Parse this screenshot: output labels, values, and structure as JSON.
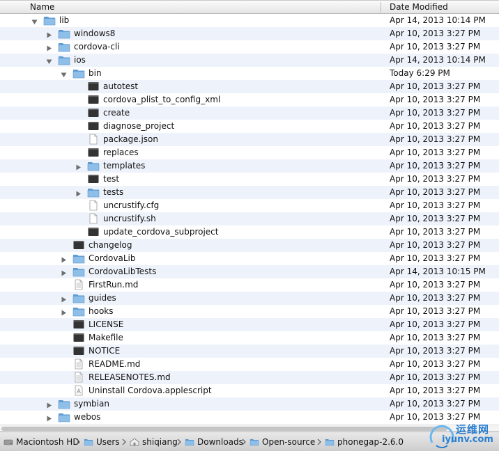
{
  "columns": {
    "name": "Name",
    "date_modified": "Date Modified"
  },
  "rows": [
    {
      "name": "lib",
      "date": "Apr 14, 2013 10:14 PM",
      "depth": 0,
      "kind": "folder",
      "disclosure": "open"
    },
    {
      "name": "windows8",
      "date": "Apr 10, 2013 3:27 PM",
      "depth": 1,
      "kind": "folder",
      "disclosure": "closed"
    },
    {
      "name": "cordova-cli",
      "date": "Apr 10, 2013 3:27 PM",
      "depth": 1,
      "kind": "folder",
      "disclosure": "closed"
    },
    {
      "name": "ios",
      "date": "Apr 14, 2013 10:14 PM",
      "depth": 1,
      "kind": "folder",
      "disclosure": "open"
    },
    {
      "name": "bin",
      "date": "Today 6:29 PM",
      "depth": 2,
      "kind": "folder",
      "disclosure": "open"
    },
    {
      "name": "autotest",
      "date": "Apr 10, 2013 3:27 PM",
      "depth": 3,
      "kind": "exec",
      "disclosure": "none"
    },
    {
      "name": "cordova_plist_to_config_xml",
      "date": "Apr 10, 2013 3:27 PM",
      "depth": 3,
      "kind": "exec",
      "disclosure": "none"
    },
    {
      "name": "create",
      "date": "Apr 10, 2013 3:27 PM",
      "depth": 3,
      "kind": "exec",
      "disclosure": "none"
    },
    {
      "name": "diagnose_project",
      "date": "Apr 10, 2013 3:27 PM",
      "depth": 3,
      "kind": "exec",
      "disclosure": "none"
    },
    {
      "name": "package.json",
      "date": "Apr 10, 2013 3:27 PM",
      "depth": 3,
      "kind": "doc",
      "disclosure": "none"
    },
    {
      "name": "replaces",
      "date": "Apr 10, 2013 3:27 PM",
      "depth": 3,
      "kind": "exec",
      "disclosure": "none"
    },
    {
      "name": "templates",
      "date": "Apr 10, 2013 3:27 PM",
      "depth": 3,
      "kind": "folder",
      "disclosure": "closed"
    },
    {
      "name": "test",
      "date": "Apr 10, 2013 3:27 PM",
      "depth": 3,
      "kind": "exec",
      "disclosure": "none"
    },
    {
      "name": "tests",
      "date": "Apr 10, 2013 3:27 PM",
      "depth": 3,
      "kind": "folder",
      "disclosure": "closed"
    },
    {
      "name": "uncrustify.cfg",
      "date": "Apr 10, 2013 3:27 PM",
      "depth": 3,
      "kind": "doc",
      "disclosure": "none"
    },
    {
      "name": "uncrustify.sh",
      "date": "Apr 10, 2013 3:27 PM",
      "depth": 3,
      "kind": "doc",
      "disclosure": "none"
    },
    {
      "name": "update_cordova_subproject",
      "date": "Apr 10, 2013 3:27 PM",
      "depth": 3,
      "kind": "exec",
      "disclosure": "none"
    },
    {
      "name": "changelog",
      "date": "Apr 10, 2013 3:27 PM",
      "depth": 2,
      "kind": "exec",
      "disclosure": "none"
    },
    {
      "name": "CordovaLib",
      "date": "Apr 10, 2013 3:27 PM",
      "depth": 2,
      "kind": "folder",
      "disclosure": "closed"
    },
    {
      "name": "CordovaLibTests",
      "date": "Apr 14, 2013 10:15 PM",
      "depth": 2,
      "kind": "folder",
      "disclosure": "closed"
    },
    {
      "name": "FirstRun.md",
      "date": "Apr 10, 2013 3:27 PM",
      "depth": 2,
      "kind": "text",
      "disclosure": "none"
    },
    {
      "name": "guides",
      "date": "Apr 10, 2013 3:27 PM",
      "depth": 2,
      "kind": "folder",
      "disclosure": "closed"
    },
    {
      "name": "hooks",
      "date": "Apr 10, 2013 3:27 PM",
      "depth": 2,
      "kind": "folder",
      "disclosure": "closed"
    },
    {
      "name": "LICENSE",
      "date": "Apr 10, 2013 3:27 PM",
      "depth": 2,
      "kind": "exec",
      "disclosure": "none"
    },
    {
      "name": "Makefile",
      "date": "Apr 10, 2013 3:27 PM",
      "depth": 2,
      "kind": "exec",
      "disclosure": "none"
    },
    {
      "name": "NOTICE",
      "date": "Apr 10, 2013 3:27 PM",
      "depth": 2,
      "kind": "exec",
      "disclosure": "none"
    },
    {
      "name": "README.md",
      "date": "Apr 10, 2013 3:27 PM",
      "depth": 2,
      "kind": "text",
      "disclosure": "none"
    },
    {
      "name": "RELEASENOTES.md",
      "date": "Apr 10, 2013 3:27 PM",
      "depth": 2,
      "kind": "text",
      "disclosure": "none"
    },
    {
      "name": "Uninstall Cordova.applescript",
      "date": "Apr 10, 2013 3:27 PM",
      "depth": 2,
      "kind": "script",
      "disclosure": "none"
    },
    {
      "name": "symbian",
      "date": "Apr 10, 2013 3:27 PM",
      "depth": 1,
      "kind": "folder",
      "disclosure": "closed"
    },
    {
      "name": "webos",
      "date": "Apr 10, 2013 3:27 PM",
      "depth": 1,
      "kind": "folder",
      "disclosure": "closed"
    }
  ],
  "pathbar": [
    {
      "label": "Maciontosh HD",
      "icon": "hard-drive-icon"
    },
    {
      "label": "Users",
      "icon": "folder-icon"
    },
    {
      "label": "shiqiang",
      "icon": "home-icon"
    },
    {
      "label": "Downloads",
      "icon": "folder-icon"
    },
    {
      "label": "Open-source",
      "icon": "folder-icon"
    },
    {
      "label": "phonegap-2.6.0",
      "icon": "folder-icon"
    }
  ],
  "watermark": {
    "text_cn": "运维网",
    "text_en": "iyunv.com"
  },
  "colors": {
    "folder": "#8ebfe8",
    "folder_dark": "#5d9bd3",
    "exec": "#333333",
    "alt_row": "#eef3fb"
  }
}
